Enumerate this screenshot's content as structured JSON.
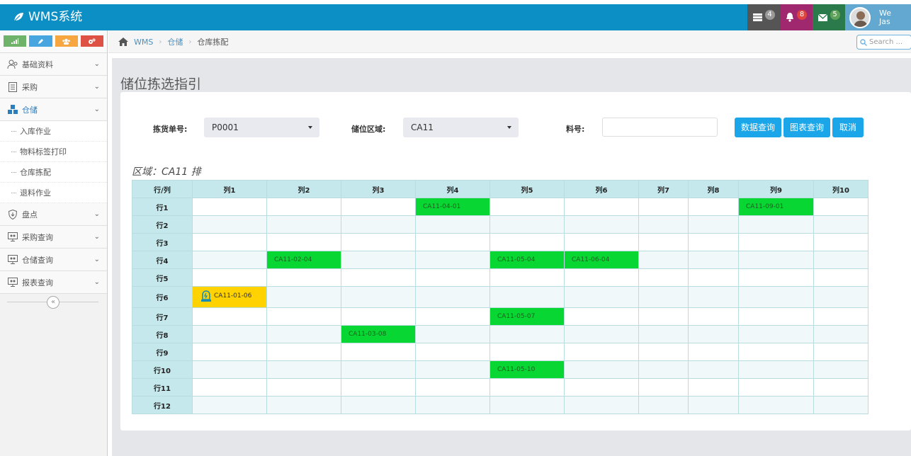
{
  "app": {
    "title": "WMS系统"
  },
  "header": {
    "badges": [
      {
        "icon": "tasks-icon",
        "count": "4",
        "color": "#999999"
      },
      {
        "icon": "bell-icon",
        "count": "8",
        "color": "#e0443e"
      },
      {
        "icon": "envelope-icon",
        "count": "5",
        "color": "#5fa25a"
      }
    ],
    "user": {
      "line1": "We",
      "line2": "Jas"
    }
  },
  "sidebar": {
    "items": [
      {
        "label": "基础资料",
        "icon": "users-icon"
      },
      {
        "label": "采购",
        "icon": "document-icon"
      },
      {
        "label": "仓储",
        "icon": "cubes-icon",
        "active": true,
        "children": [
          {
            "label": "入库作业"
          },
          {
            "label": "物料标签打印"
          },
          {
            "label": "仓库拣配"
          },
          {
            "label": "退料作业"
          }
        ]
      },
      {
        "label": "盘点",
        "icon": "shield-icon"
      },
      {
        "label": "采购查询",
        "icon": "monitor-icon"
      },
      {
        "label": "仓储查询",
        "icon": "monitor-icon"
      },
      {
        "label": "报表查询",
        "icon": "monitor-icon"
      }
    ]
  },
  "breadcrumb": {
    "home": "WMS",
    "level1": "仓储",
    "current": "仓库拣配"
  },
  "search": {
    "placeholder": "Search ..."
  },
  "page": {
    "title": "储位拣选指引"
  },
  "filters": {
    "pick_label": "拣货单号:",
    "pick_value": "P0001",
    "zone_label": "储位区域:",
    "zone_value": "CA11",
    "material_label": "料号:",
    "material_value": "",
    "btn_data": "数据查询",
    "btn_chart": "图表查询",
    "btn_cancel": "取消"
  },
  "grid": {
    "title": "区域：CA11 排",
    "corner": "行/列",
    "columns": [
      "列1",
      "列2",
      "列3",
      "列4",
      "列5",
      "列6",
      "列7",
      "列8",
      "列9",
      "列10"
    ],
    "rows": [
      "行1",
      "行2",
      "行3",
      "行4",
      "行5",
      "行6",
      "行7",
      "行8",
      "行9",
      "行10",
      "行11",
      "行12"
    ],
    "cells": [
      {
        "row": 1,
        "col": 4,
        "text": "CA11-04-01",
        "status": "filled"
      },
      {
        "row": 1,
        "col": 9,
        "text": "CA11-09-01",
        "status": "filled"
      },
      {
        "row": 4,
        "col": 2,
        "text": "CA11-02-04",
        "status": "filled"
      },
      {
        "row": 4,
        "col": 5,
        "text": "CA11-05-04",
        "status": "filled"
      },
      {
        "row": 4,
        "col": 6,
        "text": "CA11-06-04",
        "status": "filled"
      },
      {
        "row": 6,
        "col": 1,
        "text": "CA11-01-06",
        "status": "current"
      },
      {
        "row": 7,
        "col": 5,
        "text": "CA11-05-07",
        "status": "filled"
      },
      {
        "row": 8,
        "col": 3,
        "text": "CA11-03-08",
        "status": "filled"
      },
      {
        "row": 10,
        "col": 5,
        "text": "CA11-05-10",
        "status": "filled"
      }
    ],
    "colors": {
      "filled": "#08d633",
      "current": "#ffd200"
    }
  }
}
